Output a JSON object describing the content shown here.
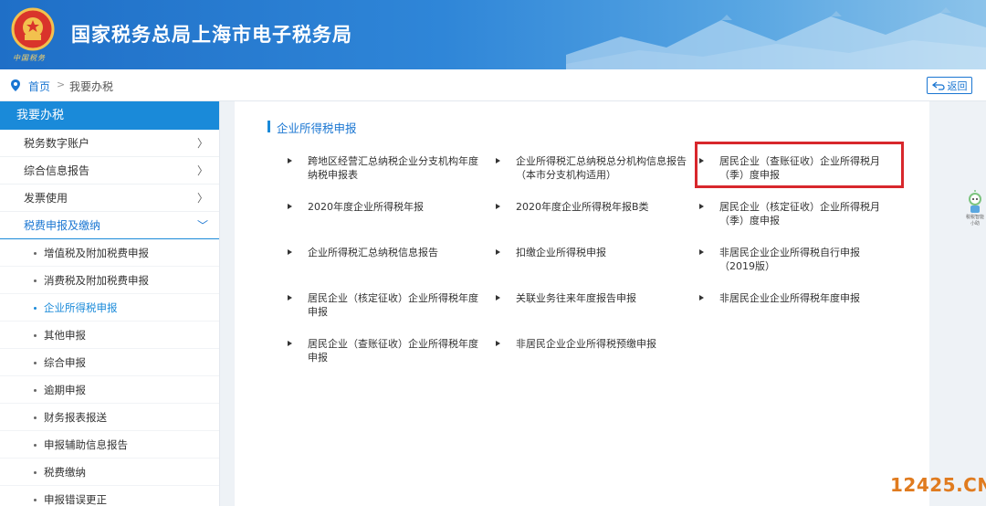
{
  "header": {
    "title": "国家税务总局上海市电子税务局",
    "emblem_caption": "中国税务"
  },
  "breadcrumb": {
    "home": "首页",
    "separator": ">",
    "current": "我要办税",
    "back_label": "返回"
  },
  "sidebar": {
    "heading": "我要办税",
    "items": [
      {
        "label": "税务数字账户",
        "chevron": "〉"
      },
      {
        "label": "综合信息报告",
        "chevron": "〉"
      },
      {
        "label": "发票使用",
        "chevron": "〉"
      },
      {
        "label": "税费申报及缴纳",
        "chevron": "﹀"
      }
    ],
    "sub_items": [
      "增值税及附加税费申报",
      "消费税及附加税费申报",
      "企业所得税申报",
      "其他申报",
      "综合申报",
      "逾期申报",
      "财务报表报送",
      "申报辅助信息报告",
      "税费缴纳",
      "申报错误更正"
    ],
    "active_sub": "企业所得税申报"
  },
  "main": {
    "section_title": "企业所得税申报",
    "links": [
      "跨地区经营汇总纳税企业分支机构年度纳税申报表",
      "企业所得税汇总纳税总分机构信息报告（本市分支机构适用）",
      "居民企业（查账征收）企业所得税月（季）度申报",
      "2020年度企业所得税年报",
      "2020年度企业所得税年报B类",
      "居民企业（核定征收）企业所得税月（季）度申报",
      "企业所得税汇总纳税信息报告",
      "扣缴企业所得税申报",
      "非居民企业企业所得税自行申报（2019版）",
      "居民企业（核定征收）企业所得税年度申报",
      "关联业务往来年度报告申报",
      "非居民企业企业所得税年度申报",
      "居民企业（查账征收）企业所得税年度申报",
      "非居民企业企业所得税预缴申报"
    ],
    "highlighted_link": "居民企业（查账征收）企业所得税月（季）度申报"
  },
  "assistant": {
    "icon": "robot-assistant-icon",
    "label": "税税智能小助"
  },
  "watermark": "12425.CN",
  "colors": {
    "brand_blue": "#1a8ad9",
    "link_blue": "#1a76d2",
    "highlight_red": "#d8272c",
    "watermark_orange": "#e07b1f"
  }
}
